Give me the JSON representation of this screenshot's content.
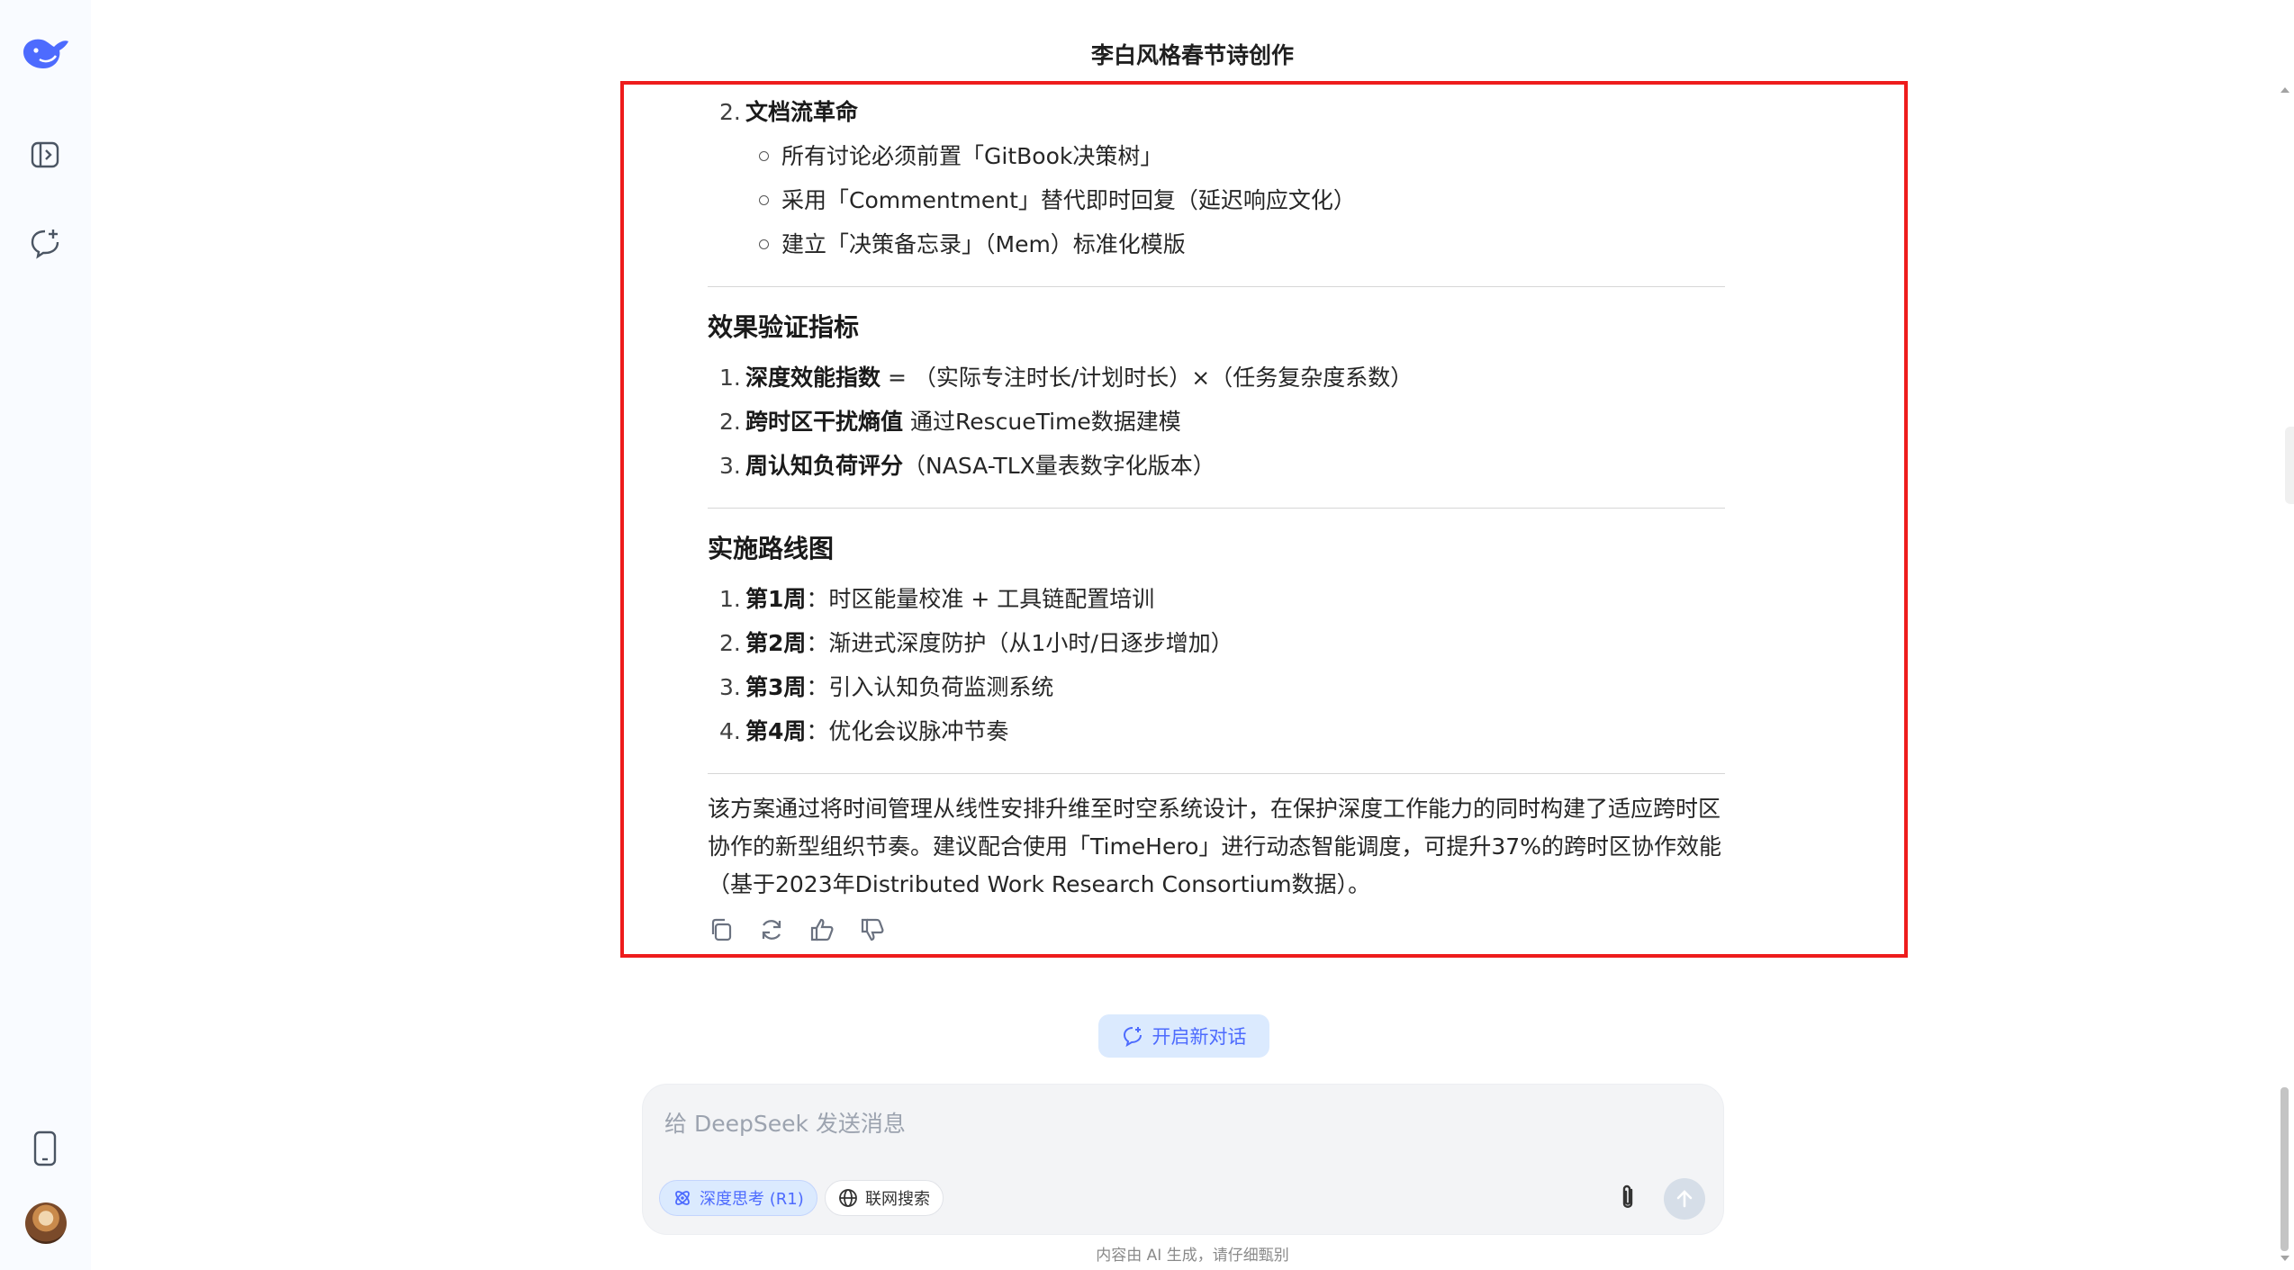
{
  "header": {
    "title": "李白风格春节诗创作"
  },
  "sidebar": {
    "logo_icon": "deepseek-whale-logo",
    "toggle_icon": "sidebar-toggle-icon",
    "new_chat_icon": "new-chat-icon",
    "mobile_icon": "mobile-phone-icon",
    "avatar_icon": "user-avatar"
  },
  "message": {
    "doc_flow": {
      "number": "2.",
      "title": "文档流革命",
      "items": [
        "所有讨论必须前置「GitBook决策树」",
        "采用「Commentment」替代即时回复（延迟响应文化）",
        "建立「决策备忘录」（Mem）标准化模版"
      ]
    },
    "metrics": {
      "title": "效果验证指标",
      "items": [
        {
          "num": "1.",
          "bold": "深度效能指数",
          "text": " = （实际专注时长/计划时长）×（任务复杂度系数）"
        },
        {
          "num": "2.",
          "bold": "跨时区干扰熵值",
          "text": " 通过RescueTime数据建模"
        },
        {
          "num": "3.",
          "bold": "周认知负荷评分",
          "text": "（NASA-TLX量表数字化版本）"
        }
      ]
    },
    "roadmap": {
      "title": "实施路线图",
      "items": [
        {
          "num": "1.",
          "bold": "第1周",
          "text": "：时区能量校准 + 工具链配置培训"
        },
        {
          "num": "2.",
          "bold": "第2周",
          "text": "：渐进式深度防护（从1小时/日逐步增加）"
        },
        {
          "num": "3.",
          "bold": "第3周",
          "text": "：引入认知负荷监测系统"
        },
        {
          "num": "4.",
          "bold": "第4周",
          "text": "：优化会议脉冲节奏"
        }
      ]
    },
    "conclusion": "该方案通过将时间管理从线性安排升维至时空系统设计，在保护深度工作能力的同时构建了适应跨时区协作的新型组织节奏。建议配合使用「TimeHero」进行动态智能调度，可提升37%的跨时区协作效能（基于2023年Distributed Work Research Consortium数据）。",
    "actions": [
      "copy-icon",
      "regenerate-icon",
      "thumbs-up-icon",
      "thumbs-down-icon"
    ]
  },
  "new_chat": {
    "label": "开启新对话"
  },
  "composer": {
    "placeholder": "给 DeepSeek 发送消息",
    "value": "",
    "deep_think_label": "深度思考 (R1)",
    "web_search_label": "联网搜索"
  },
  "footer": {
    "disclaimer": "内容由 AI 生成，请仔细甄别"
  },
  "colors": {
    "accent": "#4d6bfe",
    "accent_bg": "#dbeafe",
    "highlight_border": "#ee1c1c",
    "sidebar_bg": "#f9fbff"
  }
}
